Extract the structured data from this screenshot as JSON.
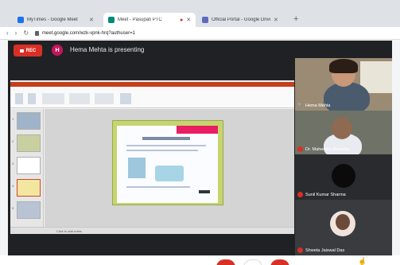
{
  "browser": {
    "tabs": [
      {
        "title": "MyTimes - Google Meet",
        "favicon_color": "#1a73e8"
      },
      {
        "title": "Meet - Pasupati PTC",
        "favicon_color": "#00897b"
      },
      {
        "title": "Official Portal - Google Drive",
        "favicon_color": "#5c6bc0"
      }
    ],
    "new_tab_symbol": "+",
    "url": "meet.google.com/wzk-vpnk-hrq?authuser=1"
  },
  "meeting": {
    "recording_label": "REC",
    "presenter_initial": "H",
    "presenter_text": "Hema Mehta is presenting"
  },
  "presentation": {
    "app": "PowerPoint",
    "statusbar_text": "Click to add notes",
    "slide_numbers": [
      "1",
      "2",
      "3",
      "4",
      "5"
    ]
  },
  "participants": [
    {
      "name": "Hema Mehta",
      "muted": false
    },
    {
      "name": "Dr. Mahendra Bahadur",
      "muted": true
    },
    {
      "name": "Sunil Kumar Sharma",
      "muted": true
    },
    {
      "name": "Shweta Jaiswal Das",
      "muted": true
    }
  ],
  "colors": {
    "meet_background": "#202124",
    "record_red": "#d93025",
    "slide_green": "#c6d56f",
    "powerpoint_red": "#c43e1c"
  }
}
